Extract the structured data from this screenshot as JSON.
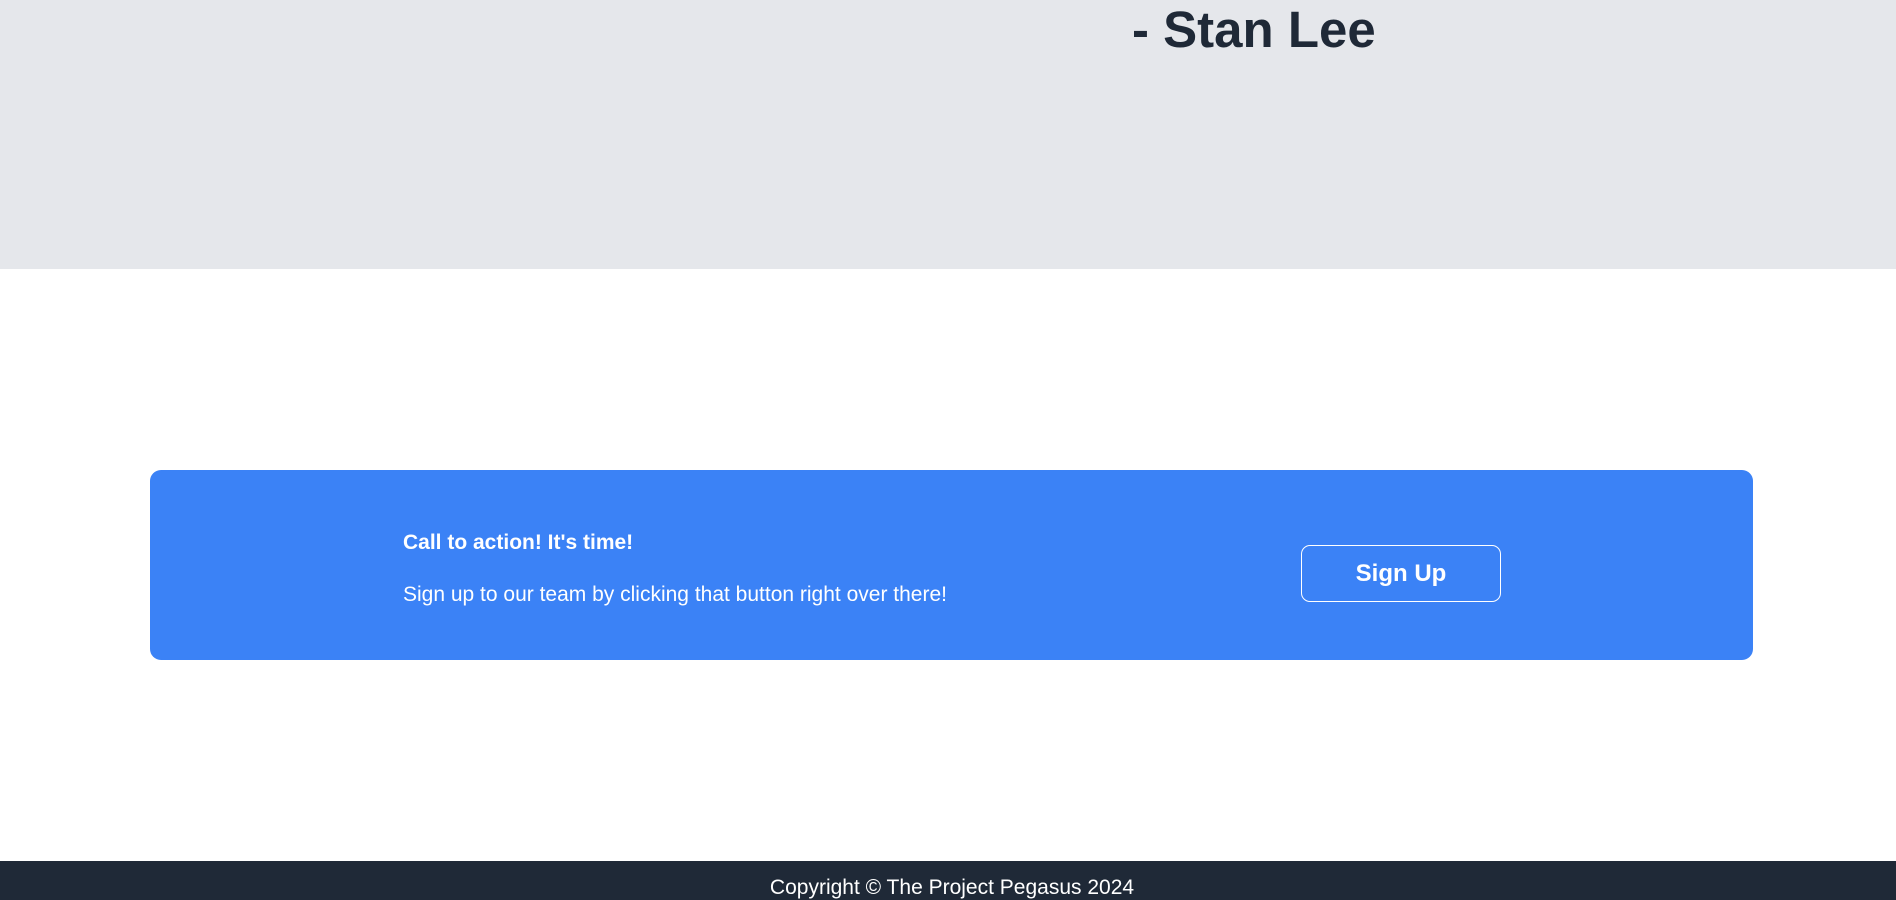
{
  "quote": {
    "author": "- Stan Lee"
  },
  "cta": {
    "heading": "Call to action! It's time!",
    "text": "Sign up to our team by clicking that button right over there!",
    "button_label": "Sign Up"
  },
  "footer": {
    "copyright": "Copyright © The Project Pegasus 2024"
  },
  "colors": {
    "quote_background": "#e5e7eb",
    "quote_text": "#1f2937",
    "cta_background": "#3b82f6",
    "footer_background": "#1f2937"
  }
}
